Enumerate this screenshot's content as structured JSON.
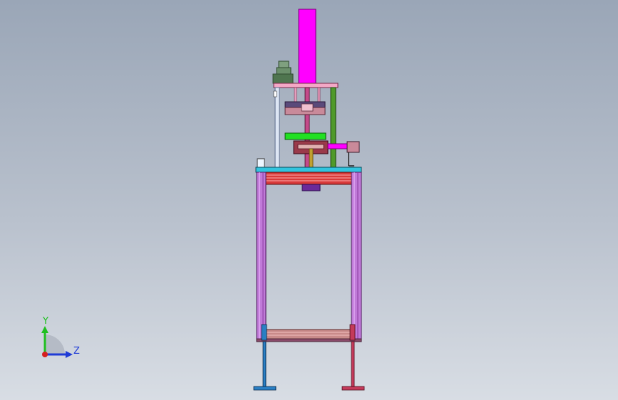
{
  "viewport": {
    "background_top": "#9aa6b7",
    "background_bottom": "#d8dde4"
  },
  "triad": {
    "y_label": "Y",
    "z_label": "Z",
    "y_color": "#1fbf1f",
    "z_color": "#1f3bd6",
    "x_color": "#d61f1f"
  },
  "model": {
    "cylinder_color": "#ff00ff",
    "motor_color": "#5f8a5f",
    "plate_color": "#f4a8c6",
    "frame_color": "#c07ad8",
    "table_color": "#32c4de",
    "belt_color": "#d83a3a",
    "bracket_color": "#22e022",
    "leg_left_color": "#2a7fc4",
    "leg_right_color": "#c43a5a",
    "rod_green_color": "#4f9a2a",
    "rod_white_color": "#dde6f4",
    "box_purple_color": "#6a2a9a"
  }
}
